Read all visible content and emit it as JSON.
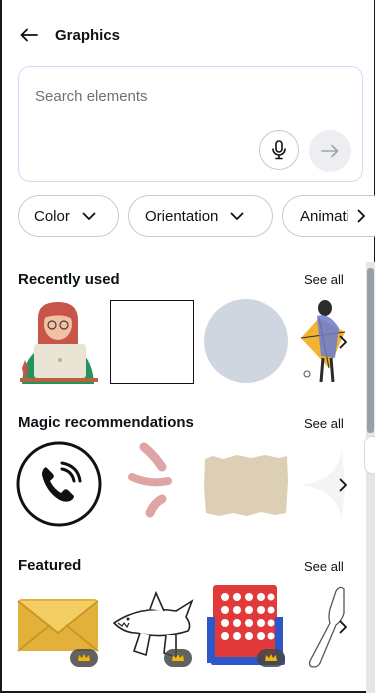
{
  "header": {
    "title": "Graphics"
  },
  "search": {
    "placeholder": "Search elements",
    "value": ""
  },
  "filters": [
    {
      "label": "Color"
    },
    {
      "label": "Orientation"
    },
    {
      "label": "Animatio"
    }
  ],
  "sections": {
    "recent": {
      "title": "Recently used",
      "see_all": "See all"
    },
    "magic": {
      "title": "Magic recommendations",
      "see_all": "See all"
    },
    "featured": {
      "title": "Featured",
      "see_all": "See all"
    }
  },
  "colors": {
    "accent_border": "#d6d9f5",
    "chip_border": "#c9cbd2",
    "circle_gray": "#cfd6e0",
    "premium_badge": "#464646",
    "crown_gold": "#f2b705"
  },
  "icons": [
    "back-arrow-icon",
    "microphone-icon",
    "arrow-right-icon",
    "chevron-down-icon",
    "chevron-right-icon",
    "crown-icon"
  ]
}
